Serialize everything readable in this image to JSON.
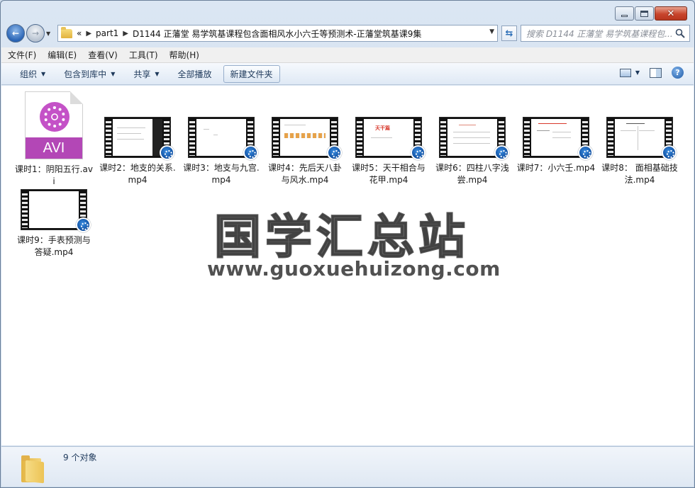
{
  "window": {
    "caption_buttons": {
      "minimize": "minimize-icon",
      "maximize": "maximize-icon",
      "close": "close-icon"
    }
  },
  "navigation": {
    "overflow": "«",
    "breadcrumbs": [
      "part1",
      "D1144 正藩堂 易学筑基课程包含面相风水小六壬等预测术-正藩堂筑基课9集"
    ],
    "search_placeholder": "搜索 D1144 正藩堂 易学筑基课程包..."
  },
  "menubar": {
    "items": [
      "文件(F)",
      "编辑(E)",
      "查看(V)",
      "工具(T)",
      "帮助(H)"
    ]
  },
  "commandbar": {
    "organize": "组织",
    "include_library": "包含到库中",
    "share": "共享",
    "play_all": "全部播放",
    "new_folder": "新建文件夹"
  },
  "files": [
    {
      "name": "课时1：阴阳五行.avi",
      "type": "avi",
      "icon_label": "AVI"
    },
    {
      "name": "课时2：地支的关系.mp4",
      "type": "mp4"
    },
    {
      "name": "课时3：地支与九宫.mp4",
      "type": "mp4"
    },
    {
      "name": "课时4：先后天八卦与风水.mp4",
      "type": "mp4"
    },
    {
      "name": "课时5：天干相合与花甲.mp4",
      "type": "mp4",
      "thumb_text": "天干篇"
    },
    {
      "name": "课时6：四柱八字浅尝.mp4",
      "type": "mp4"
    },
    {
      "name": "课时7：小六壬.mp4",
      "type": "mp4"
    },
    {
      "name": "课时8： 面相基础技法.mp4",
      "type": "mp4"
    },
    {
      "name": "课时9：手表预测与答疑.mp4",
      "type": "mp4"
    }
  ],
  "watermark": {
    "title": "国学汇总站",
    "url": "www.guoxuehuizong.com"
  },
  "details": {
    "count": "9 个对象"
  },
  "colors": {
    "avi_brand": "#b347b6",
    "accent": "#1e395b",
    "badge": "#0b4a9c"
  }
}
